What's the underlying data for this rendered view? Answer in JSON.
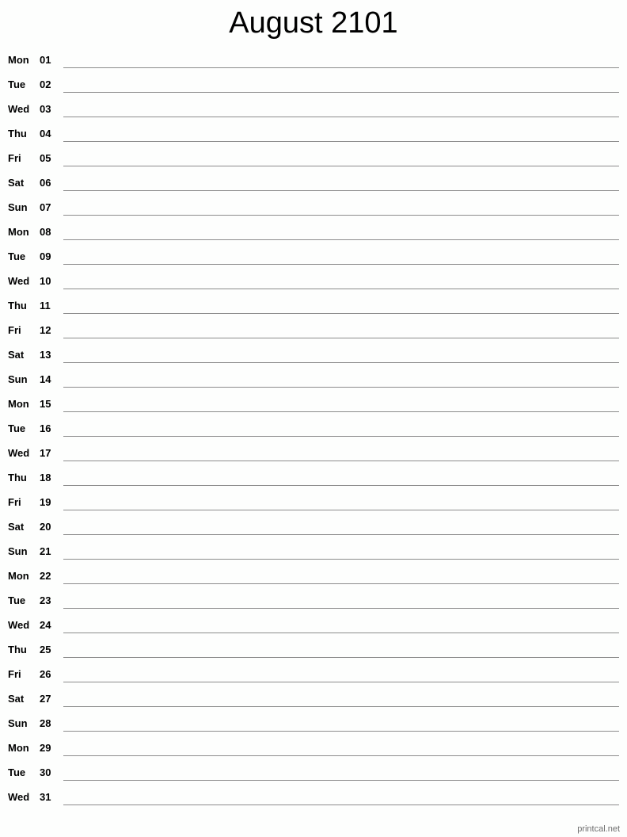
{
  "title": "August 2101",
  "days": [
    {
      "dow": "Mon",
      "num": "01"
    },
    {
      "dow": "Tue",
      "num": "02"
    },
    {
      "dow": "Wed",
      "num": "03"
    },
    {
      "dow": "Thu",
      "num": "04"
    },
    {
      "dow": "Fri",
      "num": "05"
    },
    {
      "dow": "Sat",
      "num": "06"
    },
    {
      "dow": "Sun",
      "num": "07"
    },
    {
      "dow": "Mon",
      "num": "08"
    },
    {
      "dow": "Tue",
      "num": "09"
    },
    {
      "dow": "Wed",
      "num": "10"
    },
    {
      "dow": "Thu",
      "num": "11"
    },
    {
      "dow": "Fri",
      "num": "12"
    },
    {
      "dow": "Sat",
      "num": "13"
    },
    {
      "dow": "Sun",
      "num": "14"
    },
    {
      "dow": "Mon",
      "num": "15"
    },
    {
      "dow": "Tue",
      "num": "16"
    },
    {
      "dow": "Wed",
      "num": "17"
    },
    {
      "dow": "Thu",
      "num": "18"
    },
    {
      "dow": "Fri",
      "num": "19"
    },
    {
      "dow": "Sat",
      "num": "20"
    },
    {
      "dow": "Sun",
      "num": "21"
    },
    {
      "dow": "Mon",
      "num": "22"
    },
    {
      "dow": "Tue",
      "num": "23"
    },
    {
      "dow": "Wed",
      "num": "24"
    },
    {
      "dow": "Thu",
      "num": "25"
    },
    {
      "dow": "Fri",
      "num": "26"
    },
    {
      "dow": "Sat",
      "num": "27"
    },
    {
      "dow": "Sun",
      "num": "28"
    },
    {
      "dow": "Mon",
      "num": "29"
    },
    {
      "dow": "Tue",
      "num": "30"
    },
    {
      "dow": "Wed",
      "num": "31"
    }
  ],
  "footer": "printcal.net"
}
